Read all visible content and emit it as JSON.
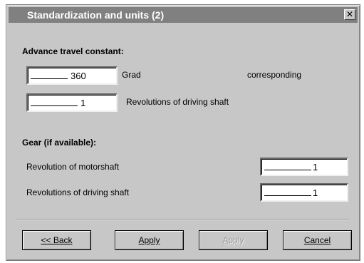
{
  "window": {
    "title": "Standardization and units (2)",
    "close_glyph": "✕"
  },
  "advance": {
    "heading": "Advance travel constant:",
    "angle_value": "360",
    "angle_unit": "Grad",
    "corresponding": "corresponding",
    "revolutions_value": "1",
    "revolutions_label": "Revolutions of driving shaft"
  },
  "gear": {
    "heading": "Gear (if available):",
    "motorshaft_label": "Revolution of motorshaft",
    "motorshaft_value": "1",
    "driving_label": "Revolutions of driving shaft",
    "driving_value": "1"
  },
  "buttons": {
    "back": "<< Back",
    "apply": "Apply",
    "apply_disabled": "Apply",
    "cancel": "Cancel"
  },
  "colors": {
    "face": "#c7c7c7",
    "titlebar": "#808080",
    "disabled_text": "#9a9a9a"
  }
}
